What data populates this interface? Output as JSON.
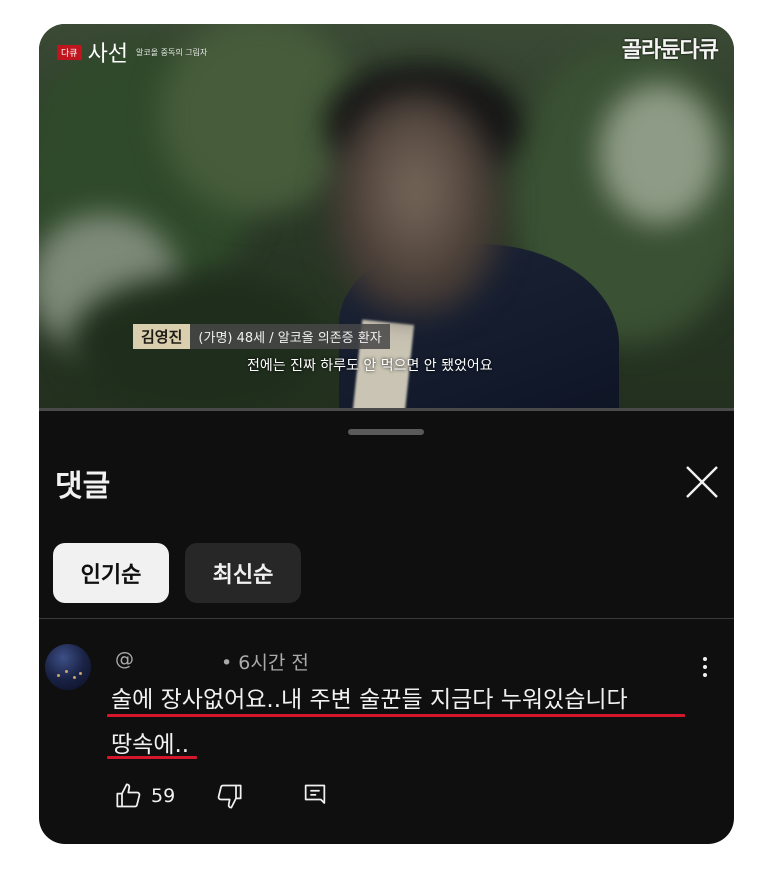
{
  "video": {
    "channel_badge": "다큐",
    "channel_name": "사선",
    "channel_sub": "알코올 중독의 그림자",
    "brand": "골라듄다큐",
    "name_tag": "김영진",
    "name_info": "(가명) 48세 / 알코올 의존증 환자",
    "subtitle": "전에는 진짜 하루도 안 먹으면 안 됐었어요"
  },
  "comments_panel": {
    "title": "댓글",
    "close_icon": "close-icon",
    "sort_chips": [
      {
        "label": "인기순",
        "selected": true
      },
      {
        "label": "최신순",
        "selected": false
      }
    ]
  },
  "comment": {
    "user": "@",
    "time": "• 6시간 전",
    "text_line1": "술에 장사없어요..내 주변 술꾼들 지금다 누워있습니다",
    "text_line2": "땅속에..",
    "likes": "59"
  },
  "colors": {
    "background": "#0f0f0f",
    "chip_selected": "#f1f1f1",
    "chip_unselected": "#272727",
    "underline": "#d6162a"
  }
}
